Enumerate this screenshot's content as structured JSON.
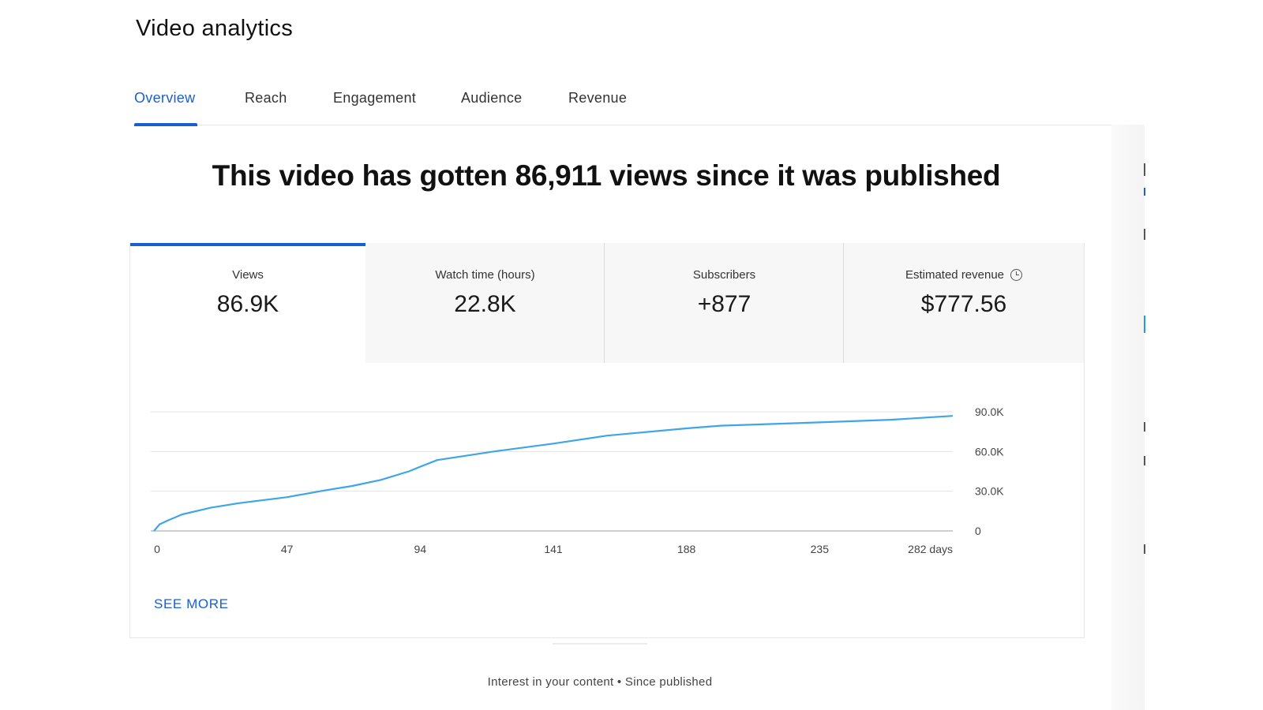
{
  "page_title": "Video analytics",
  "tabs": [
    {
      "label": "Overview",
      "active": true
    },
    {
      "label": "Reach",
      "active": false
    },
    {
      "label": "Engagement",
      "active": false
    },
    {
      "label": "Audience",
      "active": false
    },
    {
      "label": "Revenue",
      "active": false
    }
  ],
  "headline": "This video has gotten 86,911 views since it was published",
  "metrics": [
    {
      "label": "Views",
      "value": "86.9K",
      "active": true
    },
    {
      "label": "Watch time (hours)",
      "value": "22.8K",
      "active": false
    },
    {
      "label": "Subscribers",
      "value": "+877",
      "active": false
    },
    {
      "label": "Estimated revenue",
      "value": "$777.56",
      "active": false,
      "icon": "clock-icon"
    }
  ],
  "see_more": "SEE MORE",
  "footer_caption": "Interest in your content • Since published",
  "colors": {
    "accent": "#1a5fd0",
    "line": "#3ea6e8",
    "grid": "#e3e3e3"
  },
  "chart_data": {
    "type": "line",
    "x": [
      0,
      2,
      5,
      10,
      20,
      30,
      47,
      60,
      70,
      80,
      90,
      94,
      100,
      120,
      141,
      160,
      188,
      200,
      235,
      260,
      282
    ],
    "series": [
      {
        "values": [
          0,
          5000,
          8000,
          12500,
          17500,
          21000,
          25500,
          30500,
          34000,
          38500,
          45000,
          48500,
          53500,
          60000,
          66000,
          72000,
          77500,
          79500,
          82000,
          84000,
          86911
        ]
      }
    ],
    "x_ticks": [
      "0",
      "47",
      "94",
      "141",
      "188",
      "235",
      "282 days"
    ],
    "y_ticks": [
      "0",
      "30.0K",
      "60.0K",
      "90.0K"
    ],
    "xlim": [
      0,
      282
    ],
    "ylim": [
      0,
      90000
    ],
    "y_axis_side": "right",
    "grid": true
  }
}
